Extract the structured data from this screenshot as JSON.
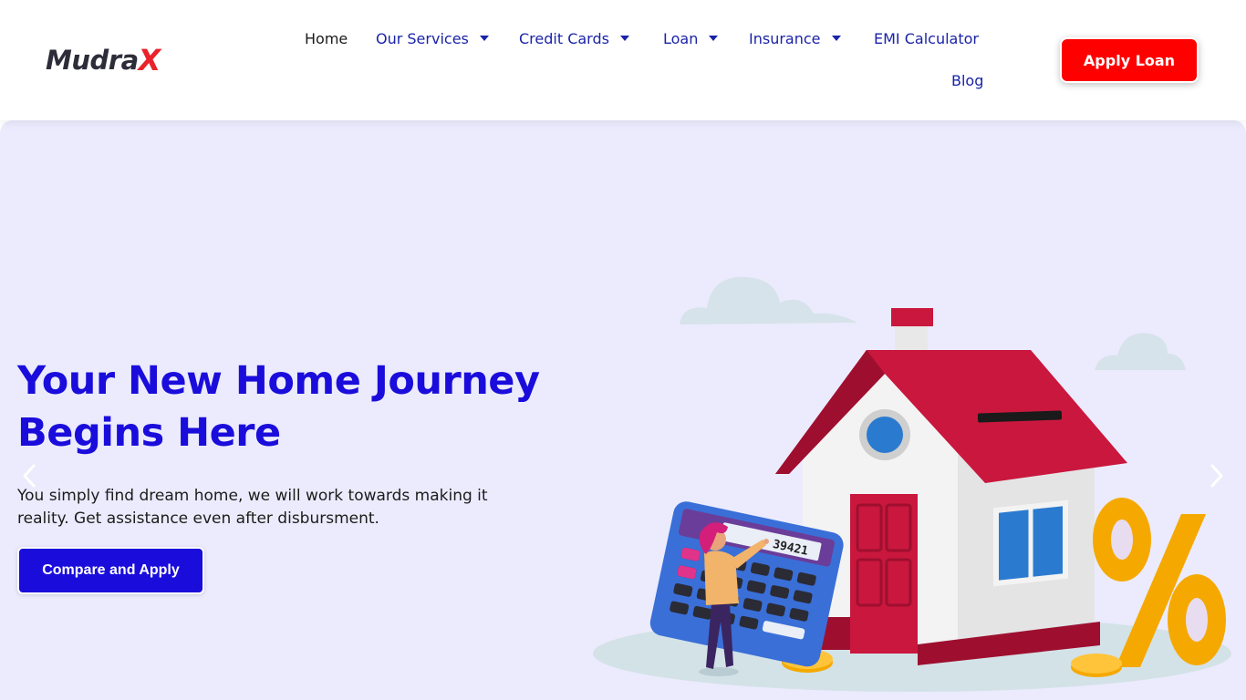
{
  "brand": {
    "logo_main": "Mudra",
    "logo_accent": "X",
    "accent_color": "#e8232b"
  },
  "nav": {
    "items": [
      {
        "label": "Home",
        "has_dropdown": false,
        "active": true
      },
      {
        "label": "Our Services",
        "has_dropdown": true
      },
      {
        "label": "Credit Cards",
        "has_dropdown": true
      },
      {
        "label": "Loan",
        "has_dropdown": true
      },
      {
        "label": "Insurance",
        "has_dropdown": true
      },
      {
        "label": "EMI Calculator",
        "has_dropdown": false
      },
      {
        "label": "Blog",
        "has_dropdown": false
      }
    ],
    "link_color": "#1a23a8"
  },
  "header": {
    "apply_label": "Apply Loan",
    "apply_color": "#ff0000"
  },
  "hero": {
    "title": "Your New Home Journey Begins Here",
    "subtitle": "You simply find dream home, we will work towards making it reality. Get assistance even after disbursment.",
    "cta_label": "Compare and Apply",
    "background": "#ebebfd",
    "title_color": "#1a0ddb",
    "prev_icon": "chevron-left-icon",
    "next_icon": "chevron-right-icon",
    "calculator_display": "39421"
  }
}
